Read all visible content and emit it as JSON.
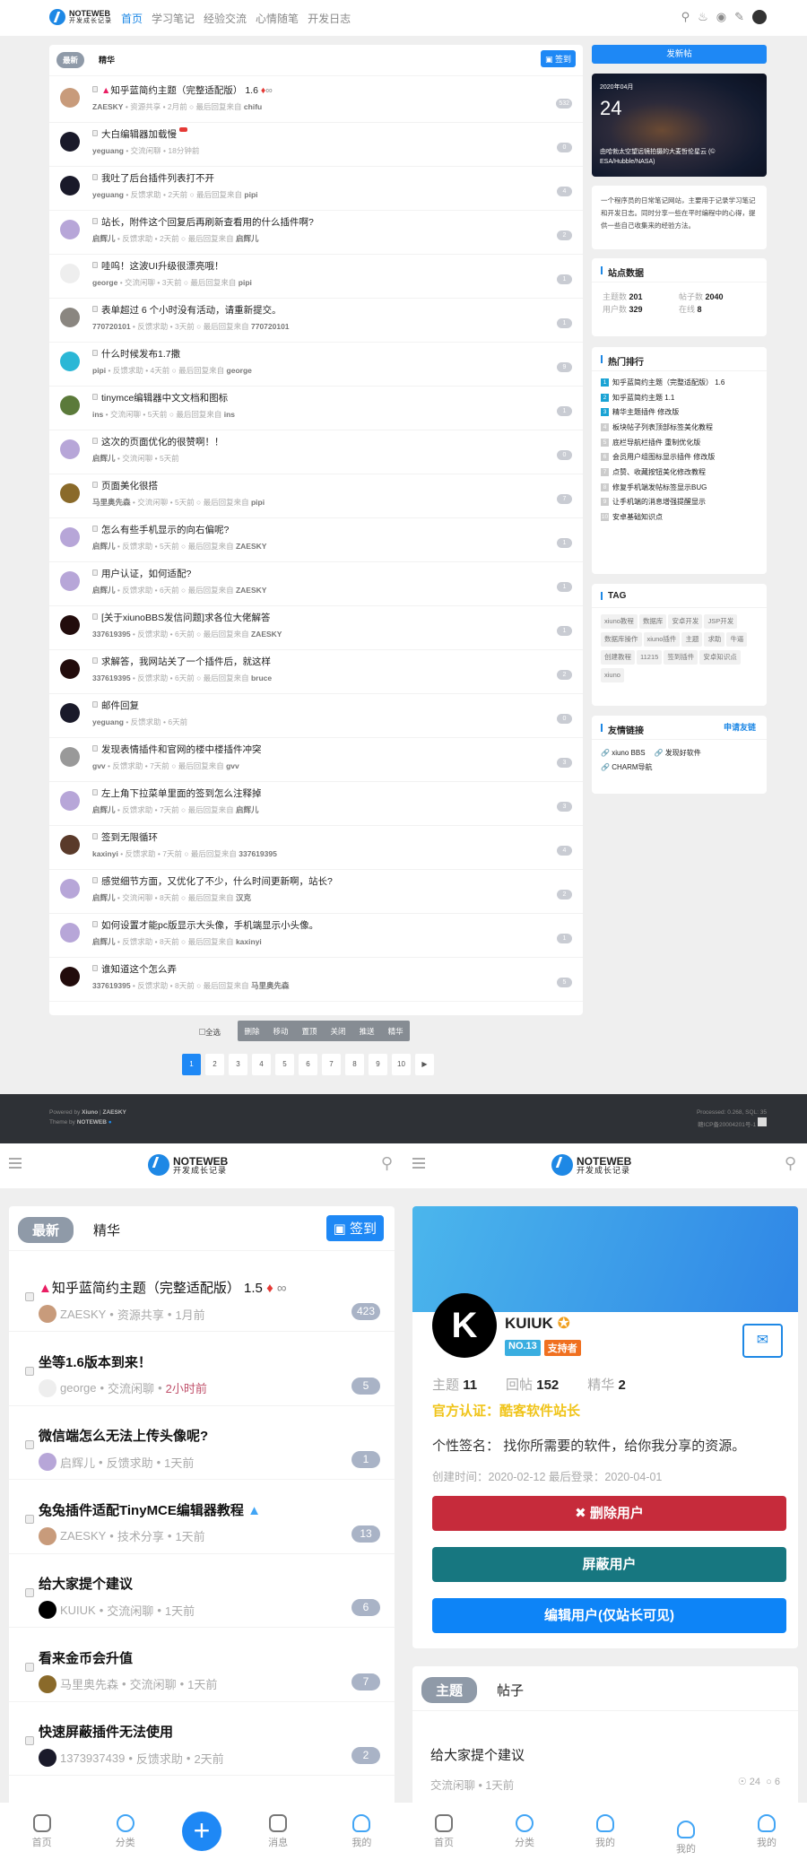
{
  "header": {
    "logo_title": "NOTEWEB",
    "logo_subtitle": "开发成长记录",
    "nav": [
      "首页",
      "学习笔记",
      "经验交流",
      "心情随笔",
      "开发日志"
    ],
    "icons": [
      "search-icon",
      "bell-icon",
      "settings-icon",
      "edit-icon"
    ]
  },
  "main": {
    "tabs": [
      "最新",
      "精华"
    ],
    "checkin_label": "签到",
    "last_reply_label": "最后回复来自",
    "topics": [
      {
        "title": "知乎蓝简约主题（完整适配版） 1.6",
        "pinned": true,
        "hot": true,
        "attachment": true,
        "author": "ZAESKY",
        "forum": "资源共享",
        "time": "2月前",
        "last_reply": "chifu",
        "count": "532"
      },
      {
        "title": "大白编辑器加载慢",
        "new": true,
        "author": "yeguang",
        "forum": "交流闲聊",
        "time": "18分钟前",
        "last_reply": "",
        "count": "0"
      },
      {
        "title": "我吐了后台插件列表打不开",
        "author": "yeguang",
        "forum": "反馈求助",
        "time": "2天前",
        "last_reply": "pipi",
        "count": "4"
      },
      {
        "title": "站长，附件这个回复后再刷新查看用的什么插件啊?",
        "author": "启辉儿",
        "forum": "反馈求助",
        "time": "2天前",
        "last_reply": "启辉儿",
        "count": "2"
      },
      {
        "title": "哇呜！这波UI升级很漂亮哦！",
        "author": "george",
        "forum": "交流闲聊",
        "time": "3天前",
        "last_reply": "pipi",
        "count": "1"
      },
      {
        "title": "表单超过 6 个小时没有活动，请重新提交。",
        "author": "770720101",
        "forum": "反馈求助",
        "time": "3天前",
        "last_reply": "770720101",
        "count": "1"
      },
      {
        "title": "什么时候发布1.7撒",
        "author": "pipi",
        "forum": "反馈求助",
        "time": "4天前",
        "last_reply": "george",
        "count": "9"
      },
      {
        "title": "tinymce编辑器中文文档和图标",
        "author": "ins",
        "forum": "交流闲聊",
        "time": "5天前",
        "last_reply": "ins",
        "count": "1"
      },
      {
        "title": "这次的页面优化的很赞啊！！",
        "author": "启辉儿",
        "forum": "交流闲聊",
        "time": "5天前",
        "last_reply": "",
        "count": "0"
      },
      {
        "title": "页面美化很搭",
        "author": "马里奥先森",
        "forum": "交流闲聊",
        "time": "5天前",
        "last_reply": "pipi",
        "count": "7"
      },
      {
        "title": "怎么有些手机显示的向右偏呢?",
        "author": "启辉儿",
        "forum": "反馈求助",
        "time": "5天前",
        "last_reply": "ZAESKY",
        "count": "1"
      },
      {
        "title": "用户认证，如何适配?",
        "author": "启辉儿",
        "forum": "反馈求助",
        "time": "6天前",
        "last_reply": "ZAESKY",
        "count": "1"
      },
      {
        "title": "[关于xiunoBBS发信问题]求各位大佬解答",
        "author": "337619395",
        "forum": "反馈求助",
        "time": "6天前",
        "last_reply": "ZAESKY",
        "count": "1"
      },
      {
        "title": "求解答，我网站关了一个插件后，就这样",
        "author": "337619395",
        "forum": "反馈求助",
        "time": "6天前",
        "last_reply": "bruce",
        "count": "2"
      },
      {
        "title": "邮件回复",
        "author": "yeguang",
        "forum": "反馈求助",
        "time": "6天前",
        "last_reply": "",
        "count": "0"
      },
      {
        "title": "发现表情插件和官网的楼中楼插件冲突",
        "author": "gvv",
        "forum": "反馈求助",
        "time": "7天前",
        "last_reply": "gvv",
        "count": "3"
      },
      {
        "title": "左上角下拉菜单里面的签到怎么注释掉",
        "author": "启辉儿",
        "forum": "反馈求助",
        "time": "7天前",
        "last_reply": "启辉儿",
        "count": "3"
      },
      {
        "title": "签到无限循环",
        "author": "kaxinyi",
        "forum": "反馈求助",
        "time": "7天前",
        "last_reply": "337619395",
        "count": "4"
      },
      {
        "title": "感觉细节方面，又优化了不少，什么时间更新啊，站长?",
        "author": "启辉儿",
        "forum": "交流闲聊",
        "time": "8天前",
        "last_reply": "汉克",
        "count": "2"
      },
      {
        "title": "如何设置才能pc版显示大头像，手机端显示小头像。",
        "author": "启辉儿",
        "forum": "反馈求助",
        "time": "8天前",
        "last_reply": "kaxinyi",
        "count": "1"
      },
      {
        "title": "谁知道这个怎么弄",
        "author": "337619395",
        "forum": "反馈求助",
        "time": "8天前",
        "last_reply": "马里奥先森",
        "count": "5"
      }
    ],
    "select_all": "全选",
    "mod_actions": [
      "删除",
      "移动",
      "置顶",
      "关闭",
      "推送",
      "精华"
    ],
    "pages": [
      "1",
      "2",
      "3",
      "4",
      "5",
      "6",
      "7",
      "8",
      "9",
      "10"
    ],
    "current_page": "1",
    "next_icon": "▶"
  },
  "sidebar": {
    "new_post": "发新帖",
    "calendar": {
      "month": "2020年04月",
      "day": "24",
      "caption": "由哈勃太空望远镜拍摄的大麦哲伦星云 (© ESA/Hubble/NASA)"
    },
    "description": "一个程序员的日常笔记网站，主要用于记录学习笔记和开发日志。同时分享一些在平时编程中的心得，提供一些自己收集来的经验方法。",
    "stats": {
      "title": "站点数据",
      "topics_label": "主题数",
      "topics": "201",
      "posts_label": "帖子数",
      "posts": "2040",
      "users_label": "用户数",
      "users": "329",
      "online_label": "在线",
      "online": "8"
    },
    "hot": {
      "title": "热门排行",
      "items": [
        "知乎蓝简约主题（完整适配版） 1.6",
        "知乎蓝简约主题 1.1",
        "精华主题插件 修改版",
        "板块帖子列表顶部标签美化教程",
        "底栏导航栏插件 重制优化版",
        "会员用户组图标显示插件 修改版",
        "点赞、收藏按钮美化修改教程",
        "修复手机端发帖标签显示BUG",
        "让手机端的消息增强提醒显示",
        "安卓基础知识点"
      ]
    },
    "tags": {
      "title": "TAG",
      "items": [
        "xiuno教程",
        "数据库",
        "安卓开发",
        "JSP开发",
        "数据库操作",
        "xiuno插件",
        "主题",
        "求助",
        "牛逼",
        "创建教程",
        "11215",
        "签到插件",
        "安卓知识点",
        "xiuno"
      ]
    },
    "links": {
      "title": "友情链接",
      "apply": "申请友链",
      "items": [
        "xiuno BBS",
        "发现好软件",
        "CHARM导航"
      ]
    }
  },
  "footer": {
    "powered_prefix": "Powered by",
    "powered": "Xiuno",
    "powered_author": "ZAESKY",
    "theme_prefix": "Theme by",
    "theme": "NOTEWEB",
    "processed": "Processed: 0.268, SQL: 35",
    "icp": "赣ICP备20004201号-1"
  },
  "mobile_list": {
    "tabs": [
      "最新",
      "精华"
    ],
    "checkin_label": "签到",
    "topics": [
      {
        "title": "知乎蓝简约主题（完整适配版） 1.5",
        "pinned": true,
        "hot": true,
        "attachment": true,
        "author": "ZAESKY",
        "forum": "资源共享",
        "time": "1月前",
        "count": "423"
      },
      {
        "title": "坐等1.6版本到来！",
        "author": "george",
        "forum": "交流闲聊",
        "time": "2小时前",
        "recent": true,
        "count": "5"
      },
      {
        "title": "微信端怎么无法上传头像呢?",
        "author": "启辉儿",
        "forum": "反馈求助",
        "time": "1天前",
        "count": "1"
      },
      {
        "title": "兔兔插件适配TinyMCE编辑器教程",
        "thumbs": true,
        "author": "ZAESKY",
        "forum": "技术分享",
        "time": "1天前",
        "count": "13"
      },
      {
        "title": "给大家提个建议",
        "author": "KUIUK",
        "forum": "交流闲聊",
        "time": "1天前",
        "count": "6"
      },
      {
        "title": "看来金币会升值",
        "author": "马里奥先森",
        "forum": "交流闲聊",
        "time": "1天前",
        "count": "7"
      },
      {
        "title": "快速屏蔽插件无法使用",
        "author": "1373937439",
        "forum": "反馈求助",
        "time": "2天前",
        "count": "2"
      }
    ],
    "bottom_nav": [
      "首页",
      "分类",
      "消息",
      "我的"
    ]
  },
  "mobile_profile": {
    "username": "KUIUK",
    "rank_badge": "NO.13",
    "role_badge": "支持者",
    "stats": [
      {
        "label": "主题",
        "value": "11"
      },
      {
        "label": "回帖",
        "value": "152"
      },
      {
        "label": "精华",
        "value": "2"
      }
    ],
    "verified": "官方认证：酷客软件站长",
    "signature_label": "个性签名：",
    "signature": "找你所需要的软件，给你我分享的资源。",
    "created": "创建时间：2020-02-12 最后登录：2020-04-01",
    "delete_user": "删除用户",
    "block_user": "屏蔽用户",
    "edit_user": "编辑用户(仅站长可见)",
    "tabs": [
      "主题",
      "帖子"
    ],
    "post": {
      "title": "给大家提个建议",
      "meta": "交流闲聊 • 1天前",
      "views": "24",
      "replies": "6"
    },
    "bottom_nav": [
      "首页",
      "分类",
      "我的",
      "我的",
      "我的"
    ],
    "colors": {
      "delete": "#c62b3b",
      "block": "#177780",
      "edit": "#0d84f7",
      "verified": "#f0c419"
    }
  }
}
